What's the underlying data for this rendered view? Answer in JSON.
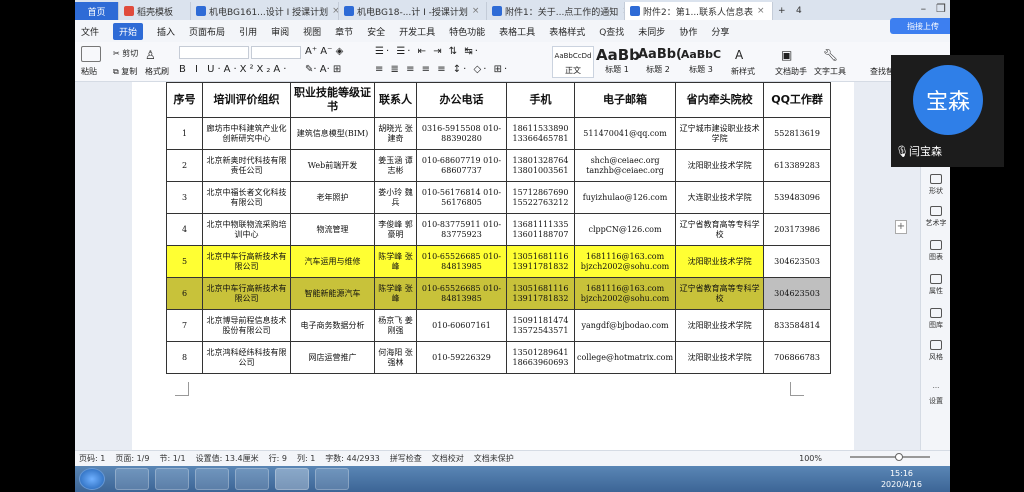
{
  "tabs": [
    {
      "label": "首页",
      "kind": "home"
    },
    {
      "label": "稻壳模板",
      "color": "#e04b3c"
    },
    {
      "label": "机电BG161...设计 I 授课计划",
      "color": "#2e6bd6"
    },
    {
      "label": "机电BG18-...计 I -授课计划",
      "color": "#2e6bd6"
    },
    {
      "label": "附件1：关于...点工作的通知",
      "color": "#2e6bd6"
    },
    {
      "label": "附件2：第1...联系人信息表",
      "color": "#2e6bd6",
      "active": true
    }
  ],
  "tab_add": "+",
  "tab_count": "4",
  "menu": [
    "文件",
    "开始",
    "插入",
    "页面布局",
    "引用",
    "审阅",
    "视图",
    "章节",
    "安全",
    "开发工具",
    "特色功能",
    "表格工具",
    "表格样式",
    "Q查找"
  ],
  "menu_right": [
    "未同步",
    "协作",
    "分享"
  ],
  "upload_label": "指接上传",
  "toolbar": {
    "paste": "粘贴",
    "cut": "剪切",
    "copy": "复制",
    "format_painter": "格式刷",
    "styles": [
      {
        "sample": "AaBbCcDd",
        "caption": "正文"
      },
      {
        "sample": "AaBb",
        "caption": "标题 1"
      },
      {
        "sample": "AaBb(",
        "caption": "标题 2"
      },
      {
        "sample": "AaBbC",
        "caption": "标题 3"
      }
    ],
    "new_style": "新样式",
    "doc_helper": "文档助手",
    "text_tools": "文字工具",
    "find_replace": "查找替换"
  },
  "table": {
    "headers": [
      "序号",
      "培训评价组织",
      "职业技能等级证书",
      "联系人",
      "办公电话",
      "手机",
      "电子邮箱",
      "省内牵头院校",
      "QQ工作群"
    ],
    "rows": [
      {
        "no": "1",
        "org": "廊坊市中科建筑产业化创新研究中心",
        "cert": "建筑信息模型(BIM)",
        "contact": "胡晓光 张建奇",
        "office": "0316-5915508 010-88390280",
        "mobile": "18611533890 13366465781",
        "email": "511470041@qq.com",
        "school": "辽宁城市建设职业技术学院",
        "qq": "552813619"
      },
      {
        "no": "2",
        "org": "北京新奥时代科技有限责任公司",
        "cert": "Web前端开发",
        "contact": "姜玉涵 谭志彬",
        "office": "010-68607719 010-68607737",
        "mobile": "13801328764 13801003561",
        "email": "shch@ceiaec.org tanzhb@ceiaec.org",
        "school": "沈阳职业技术学院",
        "qq": "613389283"
      },
      {
        "no": "3",
        "org": "北京中福长者文化科技有限公司",
        "cert": "老年照护",
        "contact": "娄小玲 魏 兵",
        "office": "010-56176814 010-56176805",
        "mobile": "15712867690 15522763212",
        "email": "fuyizhulao@126.com",
        "school": "大连职业技术学院",
        "qq": "539483096"
      },
      {
        "no": "4",
        "org": "北京中物联物流采购培训中心",
        "cert": "物流管理",
        "contact": "李俊峰 郭豪明",
        "office": "010-83775911 010-83775923",
        "mobile": "13681111335 13601188707",
        "email": "clppCN@126.com",
        "school": "辽宁省教育高等专科学校",
        "qq": "203173986"
      },
      {
        "no": "5",
        "org": "北京中车行高新技术有限公司",
        "cert": "汽车运用与维修",
        "contact": "陈学峰 张 峰",
        "office": "010-65526685 010-84813985",
        "mobile": "13051681116 13911781832",
        "email": "1681116@163.com bjzch2002@sohu.com",
        "school": "沈阳职业技术学院",
        "qq": "304623503",
        "highlight": true
      },
      {
        "no": "6",
        "org": "北京中车行高新技术有限公司",
        "cert": "智能新能源汽车",
        "contact": "陈学峰 张 峰",
        "office": "010-65526685 010-84813985",
        "mobile": "13051681116 13911781832",
        "email": "1681116@163.com bjzch2002@sohu.com",
        "school": "辽宁省教育高等专科学校",
        "qq": "304623503",
        "highlight": true,
        "selected": true
      },
      {
        "no": "7",
        "org": "北京博导前程信息技术股份有限公司",
        "cert": "电子商务数据分析",
        "contact": "杨京飞 姜刚强",
        "office": "010-60607161",
        "mobile": "15091181474 13572543571",
        "email": "yangdf@bjbodao.com",
        "school": "沈阳职业技术学院",
        "qq": "833584814"
      },
      {
        "no": "8",
        "org": "北京鸿科经纬科技有限公司",
        "cert": "网店运营推广",
        "contact": "何海阳 张强林",
        "office": "010-59226329",
        "mobile": "13501289641 18663960693",
        "email": "college@hotmatrix.com",
        "school": "沈阳职业技术学院",
        "qq": "706866783"
      }
    ]
  },
  "right_sidebar": [
    "形状",
    "艺术字",
    "图表",
    "属性",
    "图库",
    "风格",
    "设置"
  ],
  "status": {
    "page_num": "页码: 1",
    "pages": "页面: 1/9",
    "section": "节: 1/1",
    "setting": "设置值: 13.4厘米",
    "row": "行: 9",
    "col": "列: 1",
    "words": "字数: 44/2933",
    "spell": "拼写检查",
    "proof": "文档校对",
    "protect": "文档未保护",
    "zoom": "100%"
  },
  "zoom_fraction": 0.62,
  "clock": {
    "time": "15:16",
    "date": "2020/4/16"
  },
  "overlay": {
    "avatar_text": "宝森",
    "name": "闫宝森"
  }
}
